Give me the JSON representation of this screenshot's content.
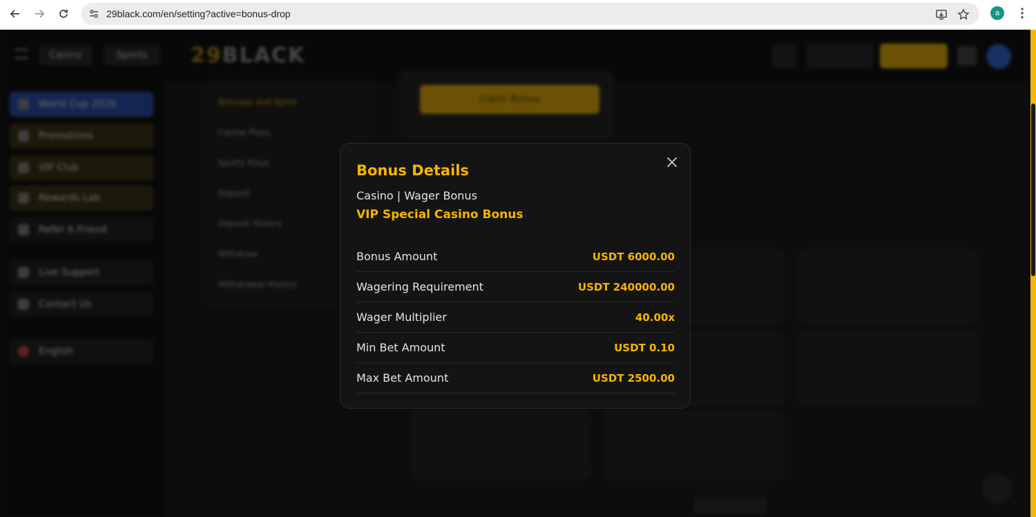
{
  "browser": {
    "url": "29black.com/en/setting?active=bonus-drop",
    "profile_initial": "a"
  },
  "background": {
    "nav": {
      "casino": "Casino",
      "sports": "Sports"
    },
    "logo": {
      "num": "29",
      "word": "BLACK"
    },
    "sidebar": [
      "World Cup 2026",
      "Promotions",
      "VIP Club",
      "Rewards Lab",
      "Refer A Friend",
      "Live Support",
      "Contact Us",
      "English"
    ],
    "menu": [
      "Bonuses and Spins",
      "Casino Plays",
      "Sports Plays",
      "Deposit",
      "Deposit History",
      "Withdraw",
      "Withdrawal History"
    ],
    "claim_label": "Claim Bonus"
  },
  "modal": {
    "title": "Bonus Details",
    "category": "Casino | Wager Bonus",
    "bonus_name": "VIP Special Casino Bonus",
    "rows": [
      {
        "label": "Bonus Amount",
        "value": "USDT 6000.00"
      },
      {
        "label": "Wagering Requirement",
        "value": "USDT 240000.00"
      },
      {
        "label": "Wager Multiplier",
        "value": "40.00x"
      },
      {
        "label": "Min Bet Amount",
        "value": "USDT 0.10"
      },
      {
        "label": "Max Bet Amount",
        "value": "USDT 2500.00"
      }
    ]
  },
  "colors": {
    "accent": "#f7b500",
    "modal_bg": "#141414",
    "page_bg": "#0d0d0d"
  }
}
